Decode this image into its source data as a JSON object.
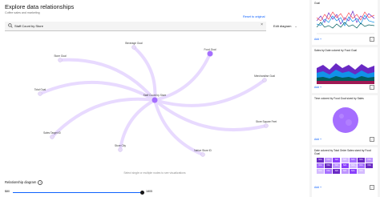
{
  "main": {
    "title": "Explore data relationships",
    "subtitle": "Coffee sales and marketing",
    "reset_label": "Reset to original",
    "search_value": "Staff Count by Store",
    "edit_diagram_label": "Edit diagram",
    "hint": "Select single or multiple nodes to see visualizations",
    "relationship_label": "Relationship diagram",
    "slider": {
      "min_label": "$80",
      "max_label": "1805",
      "value_fraction": 0.97
    }
  },
  "graph": {
    "center": {
      "label": "Staff Count by Store"
    },
    "nodes": [
      {
        "label": "Beverage Goal"
      },
      {
        "label": "Food Goal"
      },
      {
        "label": "Store Goal"
      },
      {
        "label": "Merchandise Goal"
      },
      {
        "label": "Total Goal"
      },
      {
        "label": "Store Square Feet"
      },
      {
        "label": "Sales Target ID"
      },
      {
        "label": "Store City"
      },
      {
        "label": "Native Store ID"
      }
    ]
  },
  "sidebar": {
    "cards": [
      {
        "title": "Goal",
        "add": "Add",
        "chart": "line"
      },
      {
        "title": "Sales by Date colored by Food Goal",
        "add": "Add",
        "chart": "area"
      },
      {
        "title": "Time colored by Food Goal sized by Sales",
        "add": "Add",
        "chart": "bubble"
      },
      {
        "title": "Date colored by Total Order Sales sized by Food Goal",
        "add": "Add",
        "chart": "heatmap",
        "cells": [
          "N/A",
          "N/A",
          "N/A",
          "N/A",
          "N/A",
          "N/A",
          "N/A",
          "N/A",
          "N/A",
          "N/A",
          "N/A",
          "N/A",
          "N/A",
          "N/A",
          "N/A",
          "N/A",
          "N/A",
          "N/A",
          "N/A",
          "N/A"
        ]
      }
    ]
  },
  "colors": {
    "accent": "#0f62fe",
    "node_light": "#e8dcf7",
    "node_dark": "#a56eff",
    "edge": "#e8daff"
  }
}
